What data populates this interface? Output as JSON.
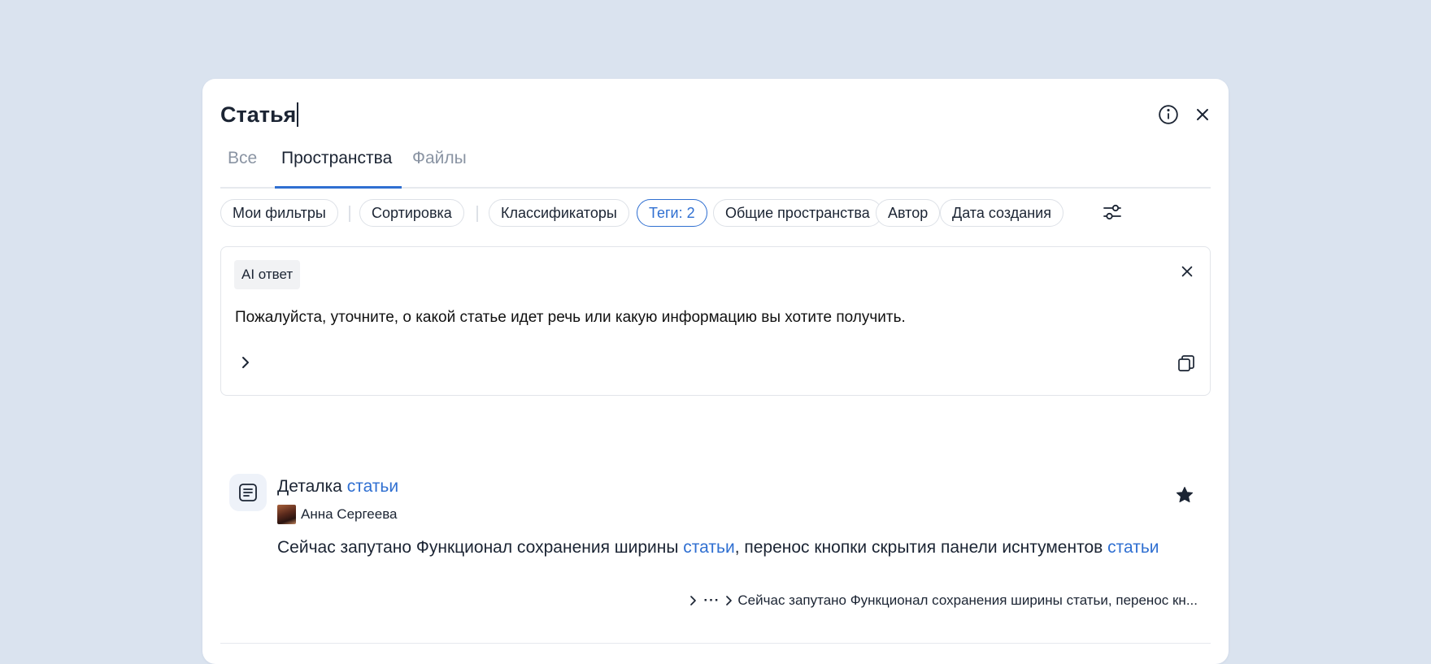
{
  "search": {
    "query": "Статья"
  },
  "tabs": [
    {
      "label": "Все",
      "active": false
    },
    {
      "label": "Пространства",
      "active": true
    },
    {
      "label": "Файлы",
      "active": false
    }
  ],
  "filters": {
    "my_filters": "Мои фильтры",
    "sorting": "Сортировка",
    "classifiers": "Классификаторы",
    "tags": "Теги: 2",
    "shared_spaces": "Общие пространства",
    "author": "Автор",
    "created_date": "Дата создания"
  },
  "ai_answer": {
    "badge": "AI ответ",
    "text": "Пожалуйста, уточните, о какой статье идет речь или какую информацию вы хотите получить."
  },
  "results": [
    {
      "title_prefix": "Деталка ",
      "title_highlight": "статьи",
      "author": "Анна Сергеева",
      "snippet_part1": "Сейчас запутано Функционал сохранения ширины ",
      "snippet_hl1": "статьи",
      "snippet_part2": ", перенос кнопки скрытия панели иснтументов ",
      "snippet_hl2": "статьи",
      "path_ellipsis": "···",
      "path_crumb": "Сейчас запутано Функционал сохранения ширины статьи, перенос кн...",
      "starred": true
    }
  ],
  "colors": {
    "accent": "#2f6fd1",
    "background": "#dae3ef",
    "text": "#1b2433"
  },
  "icons": [
    "info-icon",
    "close-icon",
    "filter-settings-icon",
    "chevron-right-icon",
    "copy-icon",
    "document-icon",
    "star-icon"
  ]
}
